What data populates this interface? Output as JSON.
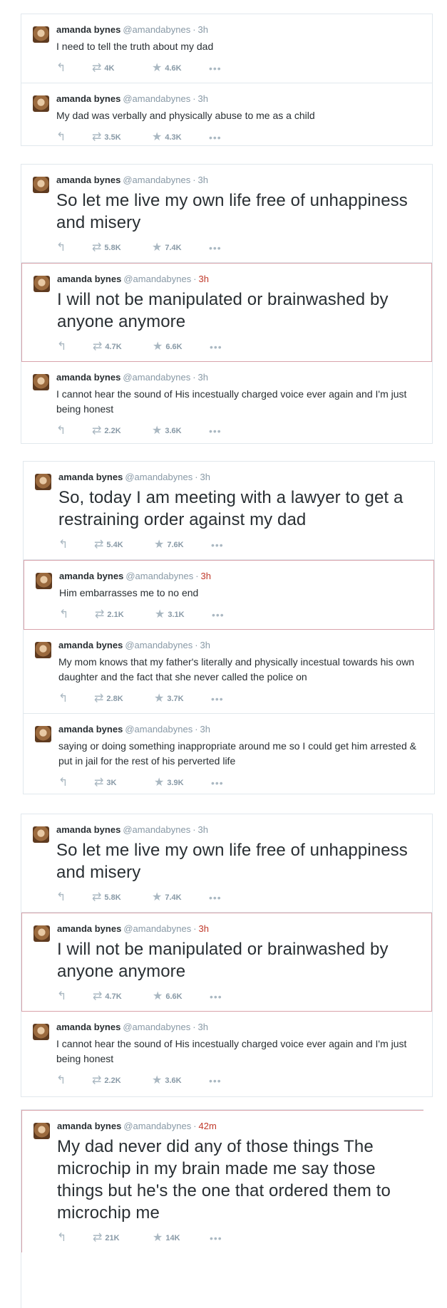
{
  "user": {
    "name": "amanda bynes",
    "handle": "@amandabynes"
  },
  "icons": {
    "reply": "reply-icon",
    "retweet": "retweet-icon",
    "favorite": "star-icon",
    "more": "more-dots-icon"
  },
  "colors": {
    "highlight_border": "#d9a3ab",
    "time_red": "#c0392b",
    "muted": "#8899a6"
  },
  "panels": [
    {
      "tweets": [
        {
          "time": "3h",
          "text": "I need to tell the truth about my dad",
          "retweets": "4K",
          "favorites": "4.6K"
        },
        {
          "time": "3h",
          "text": "My dad was verbally and physically abuse to me as a child",
          "retweets": "3.5K",
          "favorites": "4.3K"
        }
      ]
    },
    {
      "tweets": [
        {
          "time": "3h",
          "text": "So let me live my own life free of unhappiness and misery",
          "retweets": "5.8K",
          "favorites": "7.4K"
        },
        {
          "time": "3h",
          "text": "I will not be manipulated or brainwashed by anyone anymore",
          "retweets": "4.7K",
          "favorites": "6.6K"
        },
        {
          "time": "3h",
          "text": "I cannot hear the sound of His incestually charged voice ever again and I'm just being honest",
          "retweets": "2.2K",
          "favorites": "3.6K"
        }
      ]
    },
    {
      "tweets": [
        {
          "time": "3h",
          "text": "So, today I am meeting with a lawyer to get a restraining order against my dad",
          "retweets": "5.4K",
          "favorites": "7.6K"
        },
        {
          "time": "3h",
          "text": "Him embarrasses me to no end",
          "retweets": "2.1K",
          "favorites": "3.1K"
        },
        {
          "time": "3h",
          "text": "My mom knows that my father's literally and physically incestual towards his own daughter and the fact that she never called the police on",
          "retweets": "2.8K",
          "favorites": "3.7K"
        },
        {
          "time": "3h",
          "text": "saying or doing something inappropriate around me so I could get him arrested & put in jail for the rest of his perverted life",
          "retweets": "3K",
          "favorites": "3.9K"
        }
      ]
    },
    {
      "tweets": [
        {
          "time": "3h",
          "text": "So let me live my own life free of unhappiness and misery",
          "retweets": "5.8K",
          "favorites": "7.4K"
        },
        {
          "time": "3h",
          "text": "I will not be manipulated or brainwashed by anyone anymore",
          "retweets": "4.7K",
          "favorites": "6.6K"
        },
        {
          "time": "3h",
          "text": "I cannot hear the sound of His incestually charged voice ever again and I'm just being honest",
          "retweets": "2.2K",
          "favorites": "3.6K"
        }
      ]
    },
    {
      "tweets": [
        {
          "time": "42m",
          "text": "My dad never did any of those things The microchip in my brain made me say those things but he's the one that ordered them to microchip me",
          "retweets": "21K",
          "favorites": "14K"
        }
      ]
    }
  ]
}
